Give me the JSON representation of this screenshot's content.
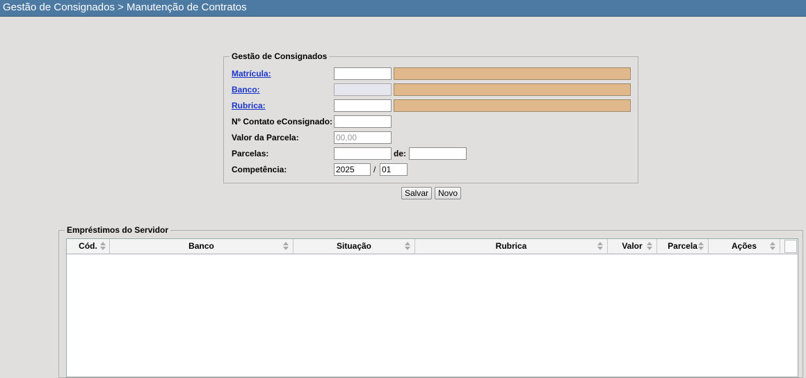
{
  "header": {
    "title": "Gestão de Consignados > Manutenção de Contratos"
  },
  "form": {
    "legend": "Gestão de Consignados",
    "matricula_label": "Matrícula:",
    "banco_label": "Banco:",
    "rubrica_label": "Rubrica:",
    "contrato_label": "Nº Contato eConsignado:",
    "valor_label": "Valor da Parcela:",
    "valor_placeholder": "00,00",
    "parcelas_label": "Parcelas:",
    "de_label": "de:",
    "competencia_label": "Competência:",
    "competencia_ano": "2025",
    "competencia_sep": "/",
    "competencia_mes": "01"
  },
  "actions": {
    "save_label": "Salvar",
    "new_label": "Novo"
  },
  "grid": {
    "legend": "Empréstimos do Servidor",
    "columns": [
      "Cód.",
      "Banco",
      "Situação",
      "Rubrica",
      "Valor",
      "Parcela",
      "Ações"
    ],
    "rows": []
  },
  "colors": {
    "titlebar": "#4c7aa3",
    "description_field": "#e0b88c",
    "link": "#1a35c9"
  }
}
